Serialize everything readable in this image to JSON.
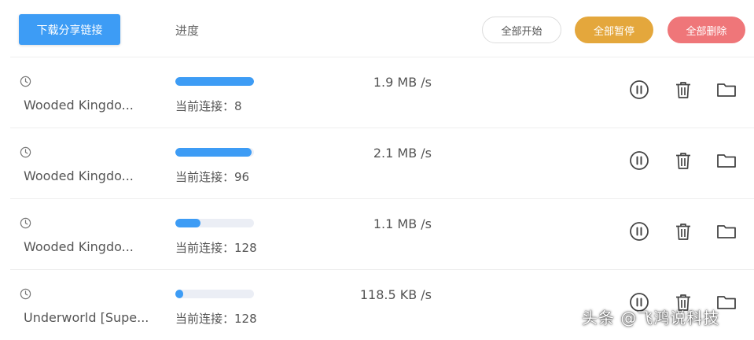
{
  "header": {
    "download_share_link": "下载分享链接",
    "progress_label": "进度",
    "start_all": "全部开始",
    "pause_all": "全部暂停",
    "delete_all": "全部删除"
  },
  "colors": {
    "primary": "#3d9cf5",
    "warning": "#e4a73c",
    "danger": "#ef7679"
  },
  "rows": [
    {
      "name": "Wooded Kingdo...",
      "progress": 1.0,
      "connections": "当前连接：8",
      "speed": "1.9 MB /s"
    },
    {
      "name": "Wooded Kingdo...",
      "progress": 0.97,
      "connections": "当前连接：96",
      "speed": "2.1 MB /s"
    },
    {
      "name": "Wooded Kingdo...",
      "progress": 0.32,
      "connections": "当前连接：128",
      "speed": "1.1 MB /s"
    },
    {
      "name": "Underworld [Supe...",
      "progress": 0.1,
      "connections": "当前连接：128",
      "speed": "118.5 KB /s"
    }
  ],
  "icons": [
    "clock-icon",
    "pause-circle-icon",
    "trash-icon",
    "folder-icon"
  ],
  "watermark": "头条 @飞鸿说科技"
}
